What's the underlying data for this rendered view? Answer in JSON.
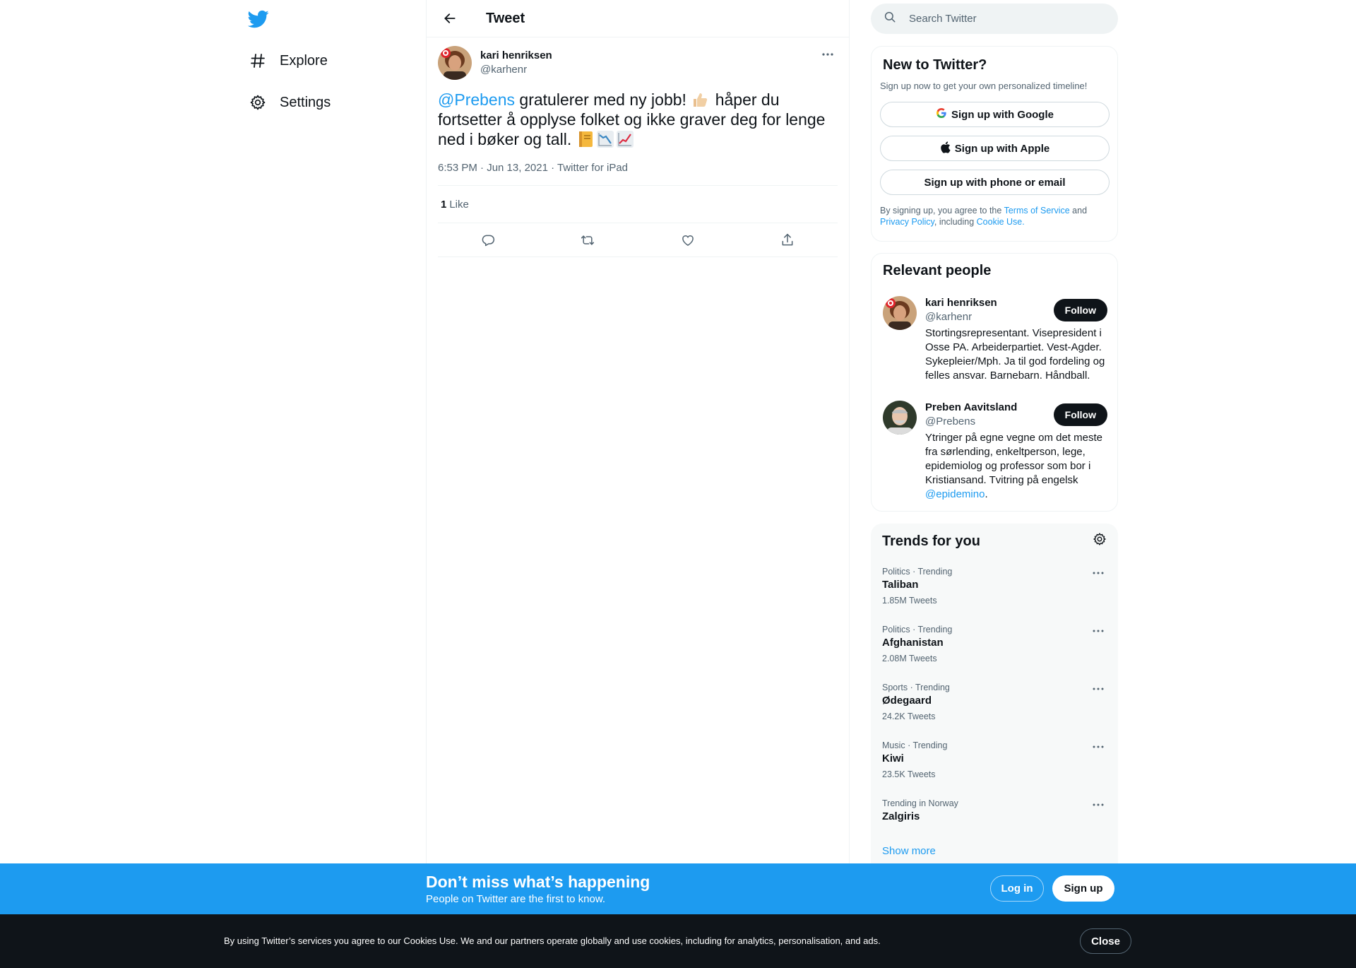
{
  "nav": {
    "logo": "twitter-bird-icon",
    "items": [
      {
        "label": "Explore",
        "icon": "hashtag-icon"
      },
      {
        "label": "Settings",
        "icon": "gear-icon"
      }
    ]
  },
  "main": {
    "header_title": "Tweet",
    "tweet": {
      "author_name": "kari henriksen",
      "author_handle": "@karhenr",
      "mention": "@Prebens",
      "text_part1": " gratulerer med ny jobb! ",
      "text_part2": " håper du fortsetter å opplyse folket og ikke graver deg for lenge ned i bøker og tall. ",
      "emojis": [
        "thumbs-up-emoji",
        "notebook-emoji",
        "chart-decreasing-emoji",
        "chart-increasing-emoji"
      ],
      "meta": "6:53 PM · Jun 13, 2021 · Twitter for iPad",
      "likes_count": "1",
      "likes_label": "Like"
    }
  },
  "search": {
    "placeholder": "Search Twitter"
  },
  "signup": {
    "title": "New to Twitter?",
    "subtitle": "Sign up now to get your own personalized timeline!",
    "google": "Sign up with Google",
    "apple": "Sign up with Apple",
    "phone": "Sign up with phone or email",
    "terms_1": "By signing up, you agree to the ",
    "terms_link1": "Terms of Service",
    "terms_2": " and ",
    "terms_link2": "Privacy Policy",
    "terms_3": ", including ",
    "terms_link3": "Cookie Use."
  },
  "people": {
    "title": "Relevant people",
    "list": [
      {
        "name": "kari henriksen",
        "handle": "@karhenr",
        "follow": "Follow",
        "bio": "Stortingsrepresentant. Visepresident i Osse PA. Arbeiderpartiet. Vest-Agder. Sykepleier/Mph. Ja til god fordeling og felles ansvar. Barnebarn. Håndball."
      },
      {
        "name": "Preben Aavitsland",
        "handle": "@Prebens",
        "follow": "Follow",
        "bio": "Ytringer på egne vegne om det meste fra sørlending, enkeltperson, lege, epidemiolog og professor som bor i Kristiansand. Tvitring på engelsk ",
        "bio_link": "@epidemino",
        "bio_end": "."
      }
    ]
  },
  "trends": {
    "title": "Trends for you",
    "items": [
      {
        "category": "Politics · Trending",
        "name": "Taliban",
        "count": "1.85M Tweets"
      },
      {
        "category": "Politics · Trending",
        "name": "Afghanistan",
        "count": "2.08M Tweets"
      },
      {
        "category": "Sports · Trending",
        "name": "Ødegaard",
        "count": "24.2K Tweets"
      },
      {
        "category": "Music · Trending",
        "name": "Kiwi",
        "count": "23.5K Tweets"
      },
      {
        "category": "Trending in Norway",
        "name": "Zalgiris",
        "count": ""
      }
    ],
    "show_more": "Show more"
  },
  "login_bar": {
    "title": "Don’t miss what’s happening",
    "subtitle": "People on Twitter are the first to know.",
    "login": "Log in",
    "signup": "Sign up"
  },
  "cookie_bar": {
    "text": "By using Twitter’s services you agree to our Cookies Use. We and our partners operate globally and use cookies, including for analytics, personalisation, and ads.",
    "close": "Close"
  },
  "colors": {
    "accent": "#1d9bf0",
    "text": "#0f1419",
    "muted": "#536471",
    "dark": "#0f1419"
  }
}
